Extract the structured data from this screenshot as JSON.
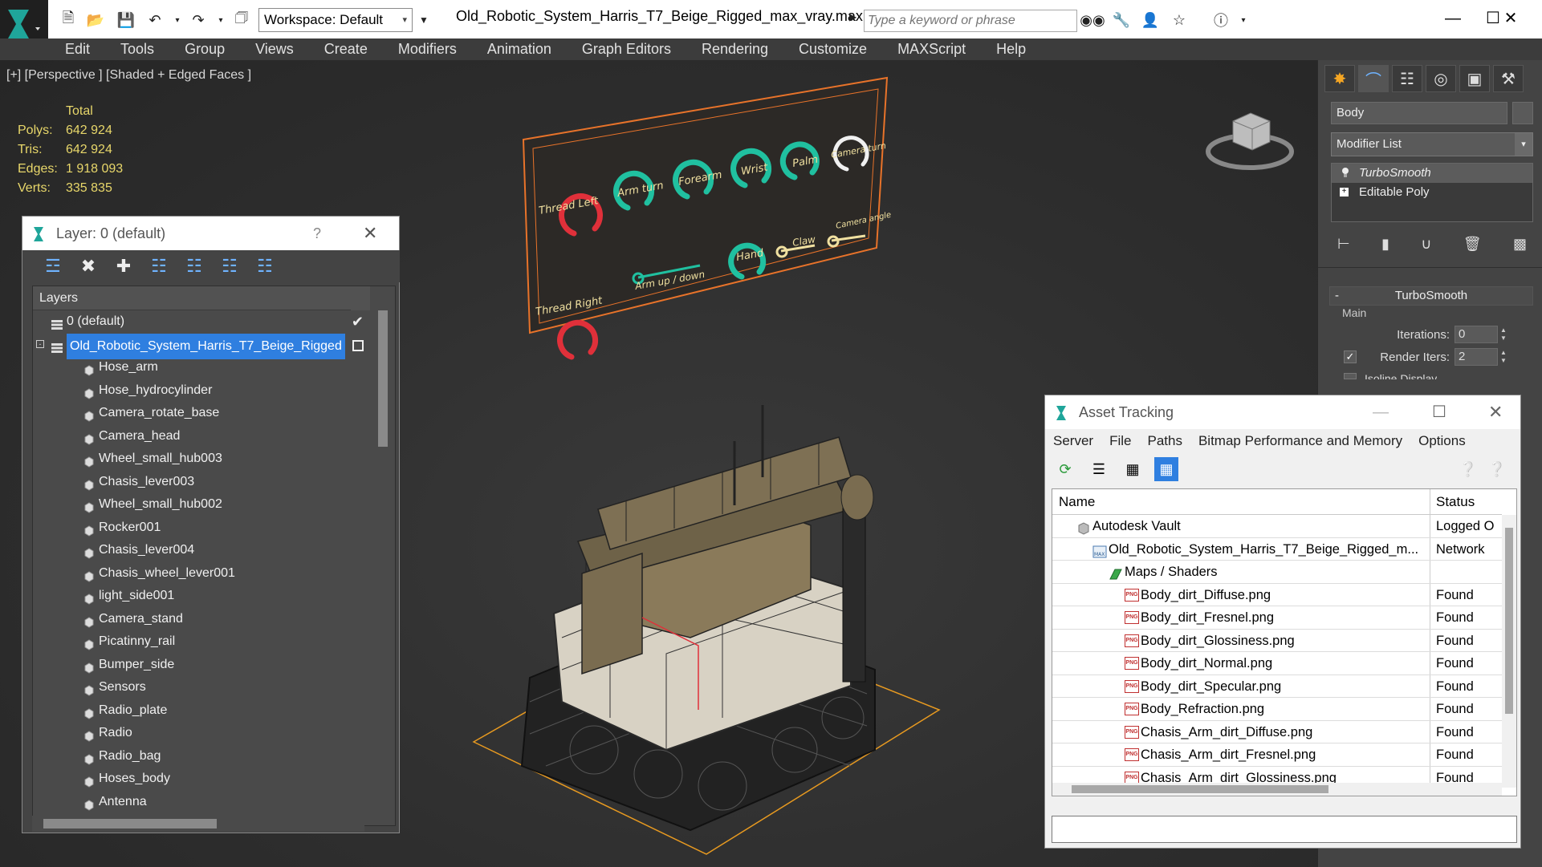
{
  "titlebar": {
    "workspace_label": "Workspace: Default",
    "file_title": "Old_Robotic_System_Harris_T7_Beige_Rigged_max_vray.max",
    "search_placeholder": "Type a keyword or phrase"
  },
  "menu": [
    "Edit",
    "Tools",
    "Group",
    "Views",
    "Create",
    "Modifiers",
    "Animation",
    "Graph Editors",
    "Rendering",
    "Customize",
    "MAXScript",
    "Help"
  ],
  "viewport": {
    "label": "[+] [Perspective ] [Shaded + Edged Faces ]",
    "stats_header": "Total",
    "stats": [
      {
        "k": "Polys:",
        "v": "642 924"
      },
      {
        "k": "Tris:",
        "v": "642 924"
      },
      {
        "k": "Edges:",
        "v": "1 918 093"
      },
      {
        "k": "Verts:",
        "v": "335 835"
      }
    ],
    "panel_labels": {
      "thread_left": "Thread Left",
      "arm_turn": "Arm turn",
      "forearm": "Forearm",
      "wrist": "Wrist",
      "palm": "Palm",
      "camera_turn": "Camera turn",
      "thread_right": "Thread Right",
      "arm_up_down": "Arm up / down",
      "hand": "Hand",
      "claw": "Claw",
      "camera_angle": "Camera angle"
    }
  },
  "command_panel": {
    "object_name": "Body",
    "modifier_list": "Modifier List",
    "stack": [
      "TurboSmooth",
      "Editable Poly"
    ],
    "rollout_title": "TurboSmooth",
    "group_main": "Main",
    "iterations_label": "Iterations:",
    "iterations_value": "0",
    "render_iters_label": "Render Iters:",
    "render_iters_value": "2",
    "isoline_label": "Isoline Display"
  },
  "layer_window": {
    "title": "Layer: 0 (default)",
    "help": "?",
    "column_header": "Layers",
    "layers": [
      {
        "name": "0 (default)",
        "level": 0,
        "type": "layer",
        "marker": "check"
      },
      {
        "name": "Old_Robotic_System_Harris_T7_Beige_Rigged",
        "level": 0,
        "type": "layer",
        "selected": true,
        "marker": "box"
      },
      {
        "name": "Hose_arm",
        "level": 1,
        "type": "object"
      },
      {
        "name": "Hose_hydrocylinder",
        "level": 1,
        "type": "object"
      },
      {
        "name": "Camera_rotate_base",
        "level": 1,
        "type": "object"
      },
      {
        "name": "Camera_head",
        "level": 1,
        "type": "object"
      },
      {
        "name": "Wheel_small_hub003",
        "level": 1,
        "type": "object"
      },
      {
        "name": "Chasis_lever003",
        "level": 1,
        "type": "object"
      },
      {
        "name": "Wheel_small_hub002",
        "level": 1,
        "type": "object"
      },
      {
        "name": "Rocker001",
        "level": 1,
        "type": "object"
      },
      {
        "name": "Chasis_lever004",
        "level": 1,
        "type": "object"
      },
      {
        "name": "Chasis_wheel_lever001",
        "level": 1,
        "type": "object"
      },
      {
        "name": "light_side001",
        "level": 1,
        "type": "object"
      },
      {
        "name": "Camera_stand",
        "level": 1,
        "type": "object"
      },
      {
        "name": "Picatinny_rail",
        "level": 1,
        "type": "object"
      },
      {
        "name": "Bumper_side",
        "level": 1,
        "type": "object"
      },
      {
        "name": "Sensors",
        "level": 1,
        "type": "object"
      },
      {
        "name": "Radio_plate",
        "level": 1,
        "type": "object"
      },
      {
        "name": "Radio",
        "level": 1,
        "type": "object"
      },
      {
        "name": "Radio_bag",
        "level": 1,
        "type": "object"
      },
      {
        "name": "Hoses_body",
        "level": 1,
        "type": "object"
      },
      {
        "name": "Antenna",
        "level": 1,
        "type": "object"
      }
    ]
  },
  "asset_window": {
    "title": "Asset Tracking",
    "menu": [
      "Server",
      "File",
      "Paths",
      "Bitmap Performance and Memory",
      "Options"
    ],
    "col_name": "Name",
    "col_status": "Status",
    "rows": [
      {
        "name": "Autodesk Vault",
        "status": "Logged O",
        "level": 0,
        "icon": "vault"
      },
      {
        "name": "Old_Robotic_System_Harris_T7_Beige_Rigged_m...",
        "status": "Network",
        "level": 1,
        "icon": "max"
      },
      {
        "name": "Maps / Shaders",
        "status": "",
        "level": 2,
        "icon": "maps"
      },
      {
        "name": "Body_dirt_Diffuse.png",
        "status": "Found",
        "level": 3,
        "icon": "png"
      },
      {
        "name": "Body_dirt_Fresnel.png",
        "status": "Found",
        "level": 3,
        "icon": "png"
      },
      {
        "name": "Body_dirt_Glossiness.png",
        "status": "Found",
        "level": 3,
        "icon": "png"
      },
      {
        "name": "Body_dirt_Normal.png",
        "status": "Found",
        "level": 3,
        "icon": "png"
      },
      {
        "name": "Body_dirt_Specular.png",
        "status": "Found",
        "level": 3,
        "icon": "png"
      },
      {
        "name": "Body_Refraction.png",
        "status": "Found",
        "level": 3,
        "icon": "png"
      },
      {
        "name": "Chasis_Arm_dirt_Diffuse.png",
        "status": "Found",
        "level": 3,
        "icon": "png"
      },
      {
        "name": "Chasis_Arm_dirt_Fresnel.png",
        "status": "Found",
        "level": 3,
        "icon": "png"
      },
      {
        "name": "Chasis_Arm_dirt_Glossiness.png",
        "status": "Found",
        "level": 3,
        "icon": "png"
      }
    ]
  },
  "colors": {
    "accent": "#2f7fe0",
    "stats_text": "#e8d76a",
    "control_panel_frame": "#e8732a",
    "dial_red": "#e0303a",
    "dial_teal": "#20c0a0",
    "dial_white": "#f0f0f0",
    "robot_beige": "#8a7a5a",
    "grid_orange": "#e89a20"
  }
}
